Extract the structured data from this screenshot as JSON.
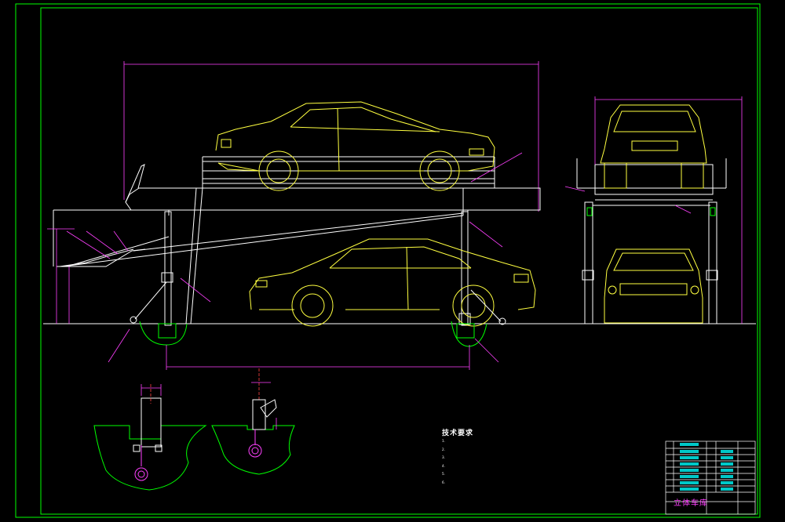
{
  "drawing": {
    "title_block": {
      "drawing_title": "立体车库"
    },
    "technical_notes": {
      "heading": "技术要求",
      "items": [
        "1.",
        "2.",
        "3.",
        "4.",
        "5.",
        "6."
      ]
    },
    "colors": {
      "background": "#000000",
      "border": "#00ff00",
      "car_outline": "#ffff40",
      "structure": "#ffffff",
      "dimension": "#ff40ff",
      "hatch_green": "#00ff00",
      "leader": "#ff40ff",
      "axis": "#ff4040",
      "sheet_line": "#00c8c8"
    }
  }
}
